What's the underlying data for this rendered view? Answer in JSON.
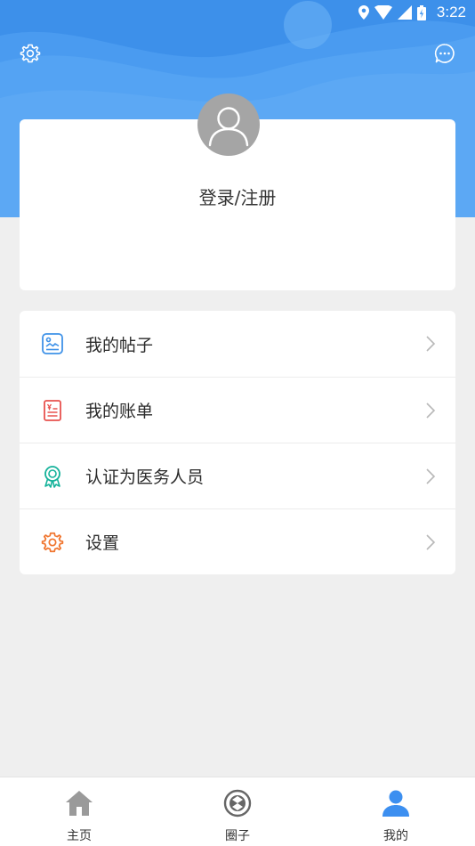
{
  "status_bar": {
    "time": "3:22",
    "icons": [
      "location-icon",
      "wifi-icon",
      "signal-icon",
      "battery-icon"
    ]
  },
  "header": {
    "settings_icon": "gear-icon",
    "message_icon": "chat-bubble-icon",
    "background_color": "#4a9bf0"
  },
  "profile": {
    "avatar_icon": "user-silhouette-icon",
    "login_label": "登录/注册"
  },
  "menu": {
    "items": [
      {
        "label": "我的帖子",
        "icon": "posts-image-icon",
        "color": "#3f92e8"
      },
      {
        "label": "我的账单",
        "icon": "bill-receipt-icon",
        "color": "#e8524f"
      },
      {
        "label": "认证为医务人员",
        "icon": "certification-badge-icon",
        "color": "#14b29a"
      },
      {
        "label": "设置",
        "icon": "gear-icon",
        "color": "#f0752e"
      }
    ]
  },
  "bottom_nav": {
    "tabs": [
      {
        "label": "主页",
        "icon": "home-icon",
        "active": false
      },
      {
        "label": "圈子",
        "icon": "circle-community-icon",
        "active": false
      },
      {
        "label": "我的",
        "icon": "user-icon",
        "active": true
      }
    ],
    "active_color": "#3c8ff0",
    "inactive_color": "#9a9a9a"
  }
}
